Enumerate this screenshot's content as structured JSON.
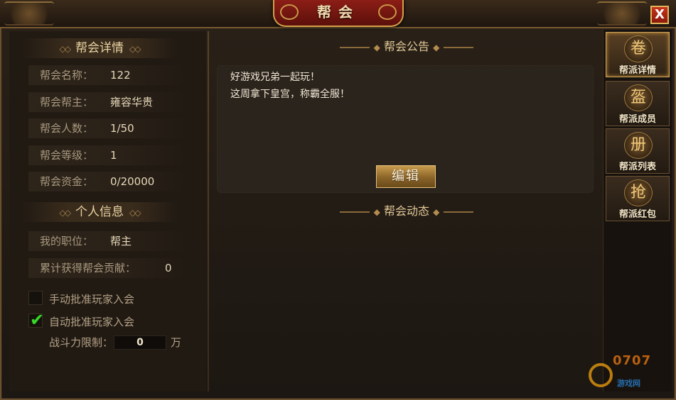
{
  "window": {
    "title": "帮会",
    "close_label": "X"
  },
  "guild_details": {
    "header": "帮会详情",
    "rows": [
      {
        "label": "帮会名称：",
        "value": "122"
      },
      {
        "label": "帮会帮主：",
        "value": "雍容华贵"
      },
      {
        "label": "帮会人数：",
        "value": "1/50"
      },
      {
        "label": "帮会等级：",
        "value": "1"
      },
      {
        "label": "帮会资金：",
        "value": "0/20000"
      }
    ]
  },
  "personal_info": {
    "header": "个人信息",
    "rows": [
      {
        "label": "我的职位：",
        "value": "帮主"
      },
      {
        "label": "累计获得帮会贡献：",
        "value": "0"
      }
    ]
  },
  "settings": {
    "manual_approve_label": "手动批准玩家入会",
    "manual_approve_checked": false,
    "auto_approve_label": "自动批准玩家入会",
    "auto_approve_checked": true,
    "power_limit_label": "战斗力限制：",
    "power_limit_value": "0",
    "power_limit_unit": "万"
  },
  "notice": {
    "header": "帮会公告",
    "lines": [
      "好游戏兄弟一起玩！",
      "这周拿下皇宫，称霸全服！"
    ],
    "edit_label": "编辑"
  },
  "activity": {
    "header": "帮会动态"
  },
  "tabs": [
    {
      "label": "帮派详情",
      "icon": "scroll-icon",
      "glyph": "卷",
      "active": true
    },
    {
      "label": "帮派成员",
      "icon": "helmet-icon",
      "glyph": "盔",
      "active": false
    },
    {
      "label": "帮派列表",
      "icon": "book-icon",
      "glyph": "册",
      "active": false
    },
    {
      "label": "帮派红包",
      "icon": "red-envelope-icon",
      "glyph": "抢",
      "active": false
    }
  ],
  "watermark": {
    "big": "0707",
    "sub": "游戏网"
  }
}
